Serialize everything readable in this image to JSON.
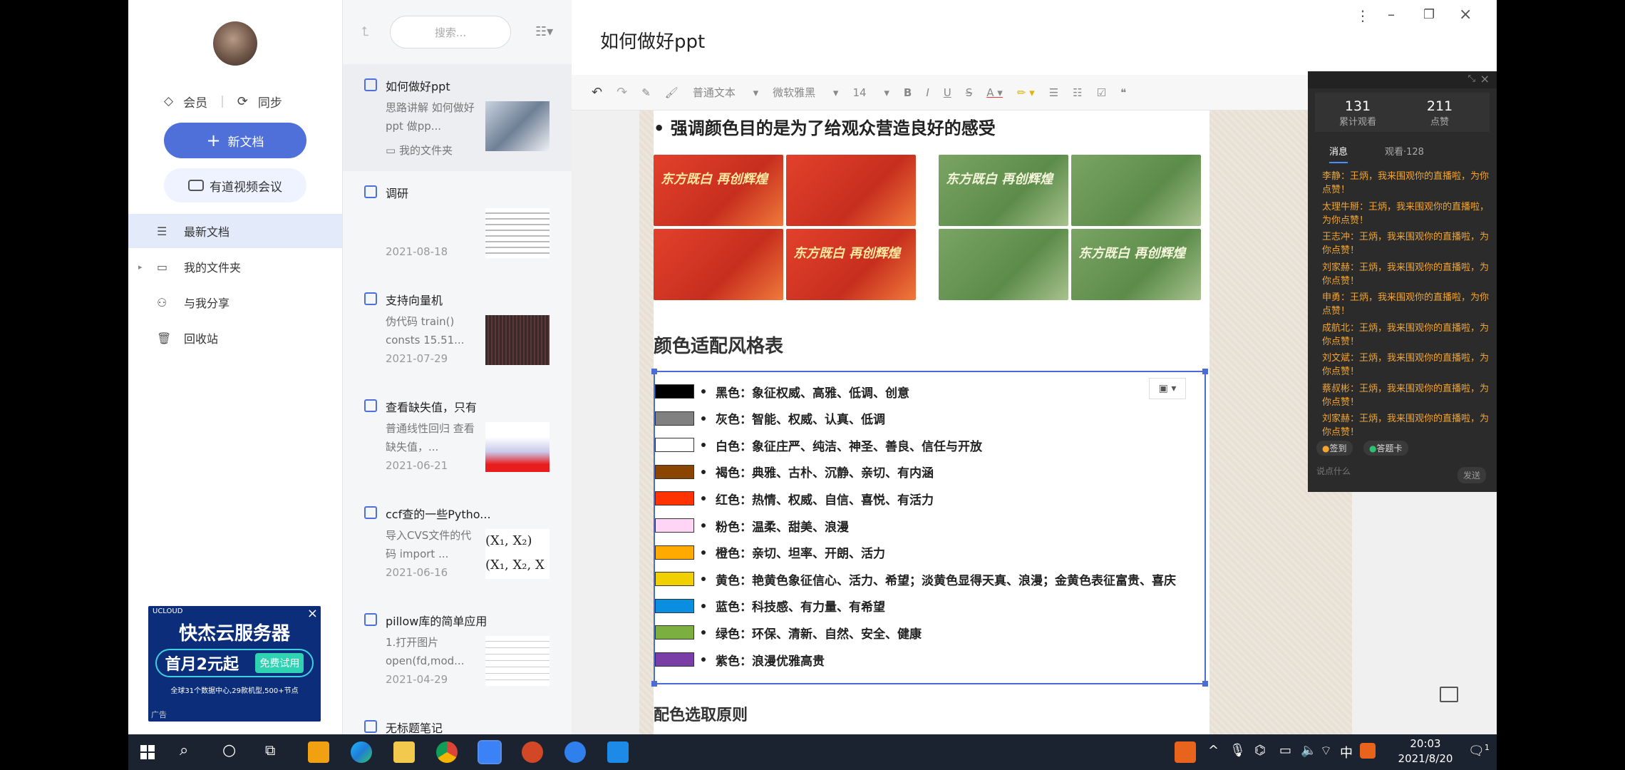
{
  "app": {
    "doc_title": "如何做好ppt",
    "window_controls": [
      "more-icon",
      "minimize-icon",
      "restore-icon",
      "close-icon"
    ]
  },
  "sidebar": {
    "vip_label": "会员",
    "sync_label": "同步",
    "new_doc_label": "新文档",
    "meeting_label": "有道视频会议",
    "nav": [
      {
        "label": "最新文档",
        "icon": "layers-icon",
        "active": true
      },
      {
        "label": "我的文件夹",
        "icon": "folder-icon",
        "active": false
      },
      {
        "label": "与我分享",
        "icon": "share-icon",
        "active": false
      },
      {
        "label": "回收站",
        "icon": "trash-icon",
        "active": false
      }
    ],
    "ad": {
      "title": "快杰云服务器",
      "promo": "首月2元起",
      "cta": "免费试用",
      "sub": "全球31个数据中心,29款机型,500+节点",
      "tag": "广告",
      "brand": "UCLOUD"
    }
  },
  "notelist": {
    "search_placeholder": "搜索...",
    "notes": [
      {
        "title": "如何做好ppt",
        "preview": "思路讲解 如何做好ppt 做pp...",
        "date": "",
        "folder": "我的文件夹",
        "thumb": "#8a9bb0"
      },
      {
        "title": "调研",
        "preview": "",
        "date": "2021-08-18",
        "thumb": "#e5e5e5"
      },
      {
        "title": "支持向量机",
        "preview": "伪代码 train() consts 15.51...",
        "date": "2021-07-29",
        "thumb": "#3b2a2a"
      },
      {
        "title": "查看缺失值，只有",
        "preview": "普通线性回归 查看缺失值，...",
        "date": "2021-06-21",
        "thumb": "#e24848"
      },
      {
        "title": "ccf查的一些Pytho...",
        "preview": "导入CVS文件的代码 import ...",
        "date": "2021-06-16",
        "thumb": "#ffffff"
      },
      {
        "title": "pillow库的简单应用",
        "preview": "1.打开图片 open(fd,mod...",
        "date": "2021-04-29",
        "thumb": "#f3f3f3"
      },
      {
        "title": "无标题笔记",
        "preview": "",
        "date": "",
        "thumb": ""
      }
    ]
  },
  "toolbar": {
    "style": "普通文本",
    "font": "微软雅黑",
    "size": "14"
  },
  "document": {
    "bullet_head": "• 强调颜色目的是为了给观众营造良好的感受",
    "slide_title": "东方既白 再创辉煌",
    "section_heading": "颜色适配风格表",
    "colors": [
      {
        "swatch": "#000000",
        "text": "黑色：象征权威、高雅、低调、创意"
      },
      {
        "swatch": "#808080",
        "text": "灰色：智能、权威、认真、低调"
      },
      {
        "swatch": "#ffffff",
        "text": "白色：象征庄严、纯洁、神圣、善良、信任与开放"
      },
      {
        "swatch": "#8b4500",
        "text": "褐色：典雅、古朴、沉静、亲切、有内涵"
      },
      {
        "swatch": "#ff3300",
        "text": "红色：热情、权威、自信、喜悦、有活力"
      },
      {
        "swatch": "#ffd5f5",
        "text": "粉色：温柔、甜美、浪漫"
      },
      {
        "swatch": "#ffaa00",
        "text": "橙色：亲切、坦率、开朗、活力"
      },
      {
        "swatch": "#f0d000",
        "text": "黄色：艳黄色象征信心、活力、希望；淡黄色显得天真、浪漫；金黄色表征富贵、喜庆"
      },
      {
        "swatch": "#0a8fe0",
        "text": "蓝色：科技感、有力量、有希望"
      },
      {
        "swatch": "#7bb040",
        "text": "绿色：环保、清新、自然、安全、健康"
      },
      {
        "swatch": "#7a3fa6",
        "text": "紫色：浪漫优雅高贵"
      }
    ],
    "subheading": "配色选取原则"
  },
  "live": {
    "views": "131",
    "views_label": "累计观看",
    "likes": "211",
    "likes_label": "点赞",
    "tab_msg": "消息",
    "tab_viewers": "观看·128",
    "messages": [
      "李静：王炳，我来围观你的直播啦，为你点赞！",
      "太理牛掰：王炳，我来围观你的直播啦，为你点赞！",
      "王志冲：王炳，我来围观你的直播啦，为你点赞！",
      "刘家赫：王炳，我来围观你的直播啦，为你点赞！",
      "申勇：王炳，我来围观你的直播啦，为你点赞！",
      "成航北：王炳，我来围观你的直播啦，为你点赞！",
      "刘文斌：王炳，我来围观你的直播啦，为你点赞！",
      "蔡叔彬：王炳，我来围观你的直播啦，为你点赞！",
      "刘家赫：王炳，我来围观你的直播啦，为你点赞！"
    ],
    "signin": "签到",
    "answer_card": "答题卡",
    "input_placeholder": "说点什么",
    "send": "发送"
  },
  "taskbar": {
    "time": "20:03",
    "date": "2021/8/20",
    "lang": "中",
    "notif_count": "1"
  }
}
